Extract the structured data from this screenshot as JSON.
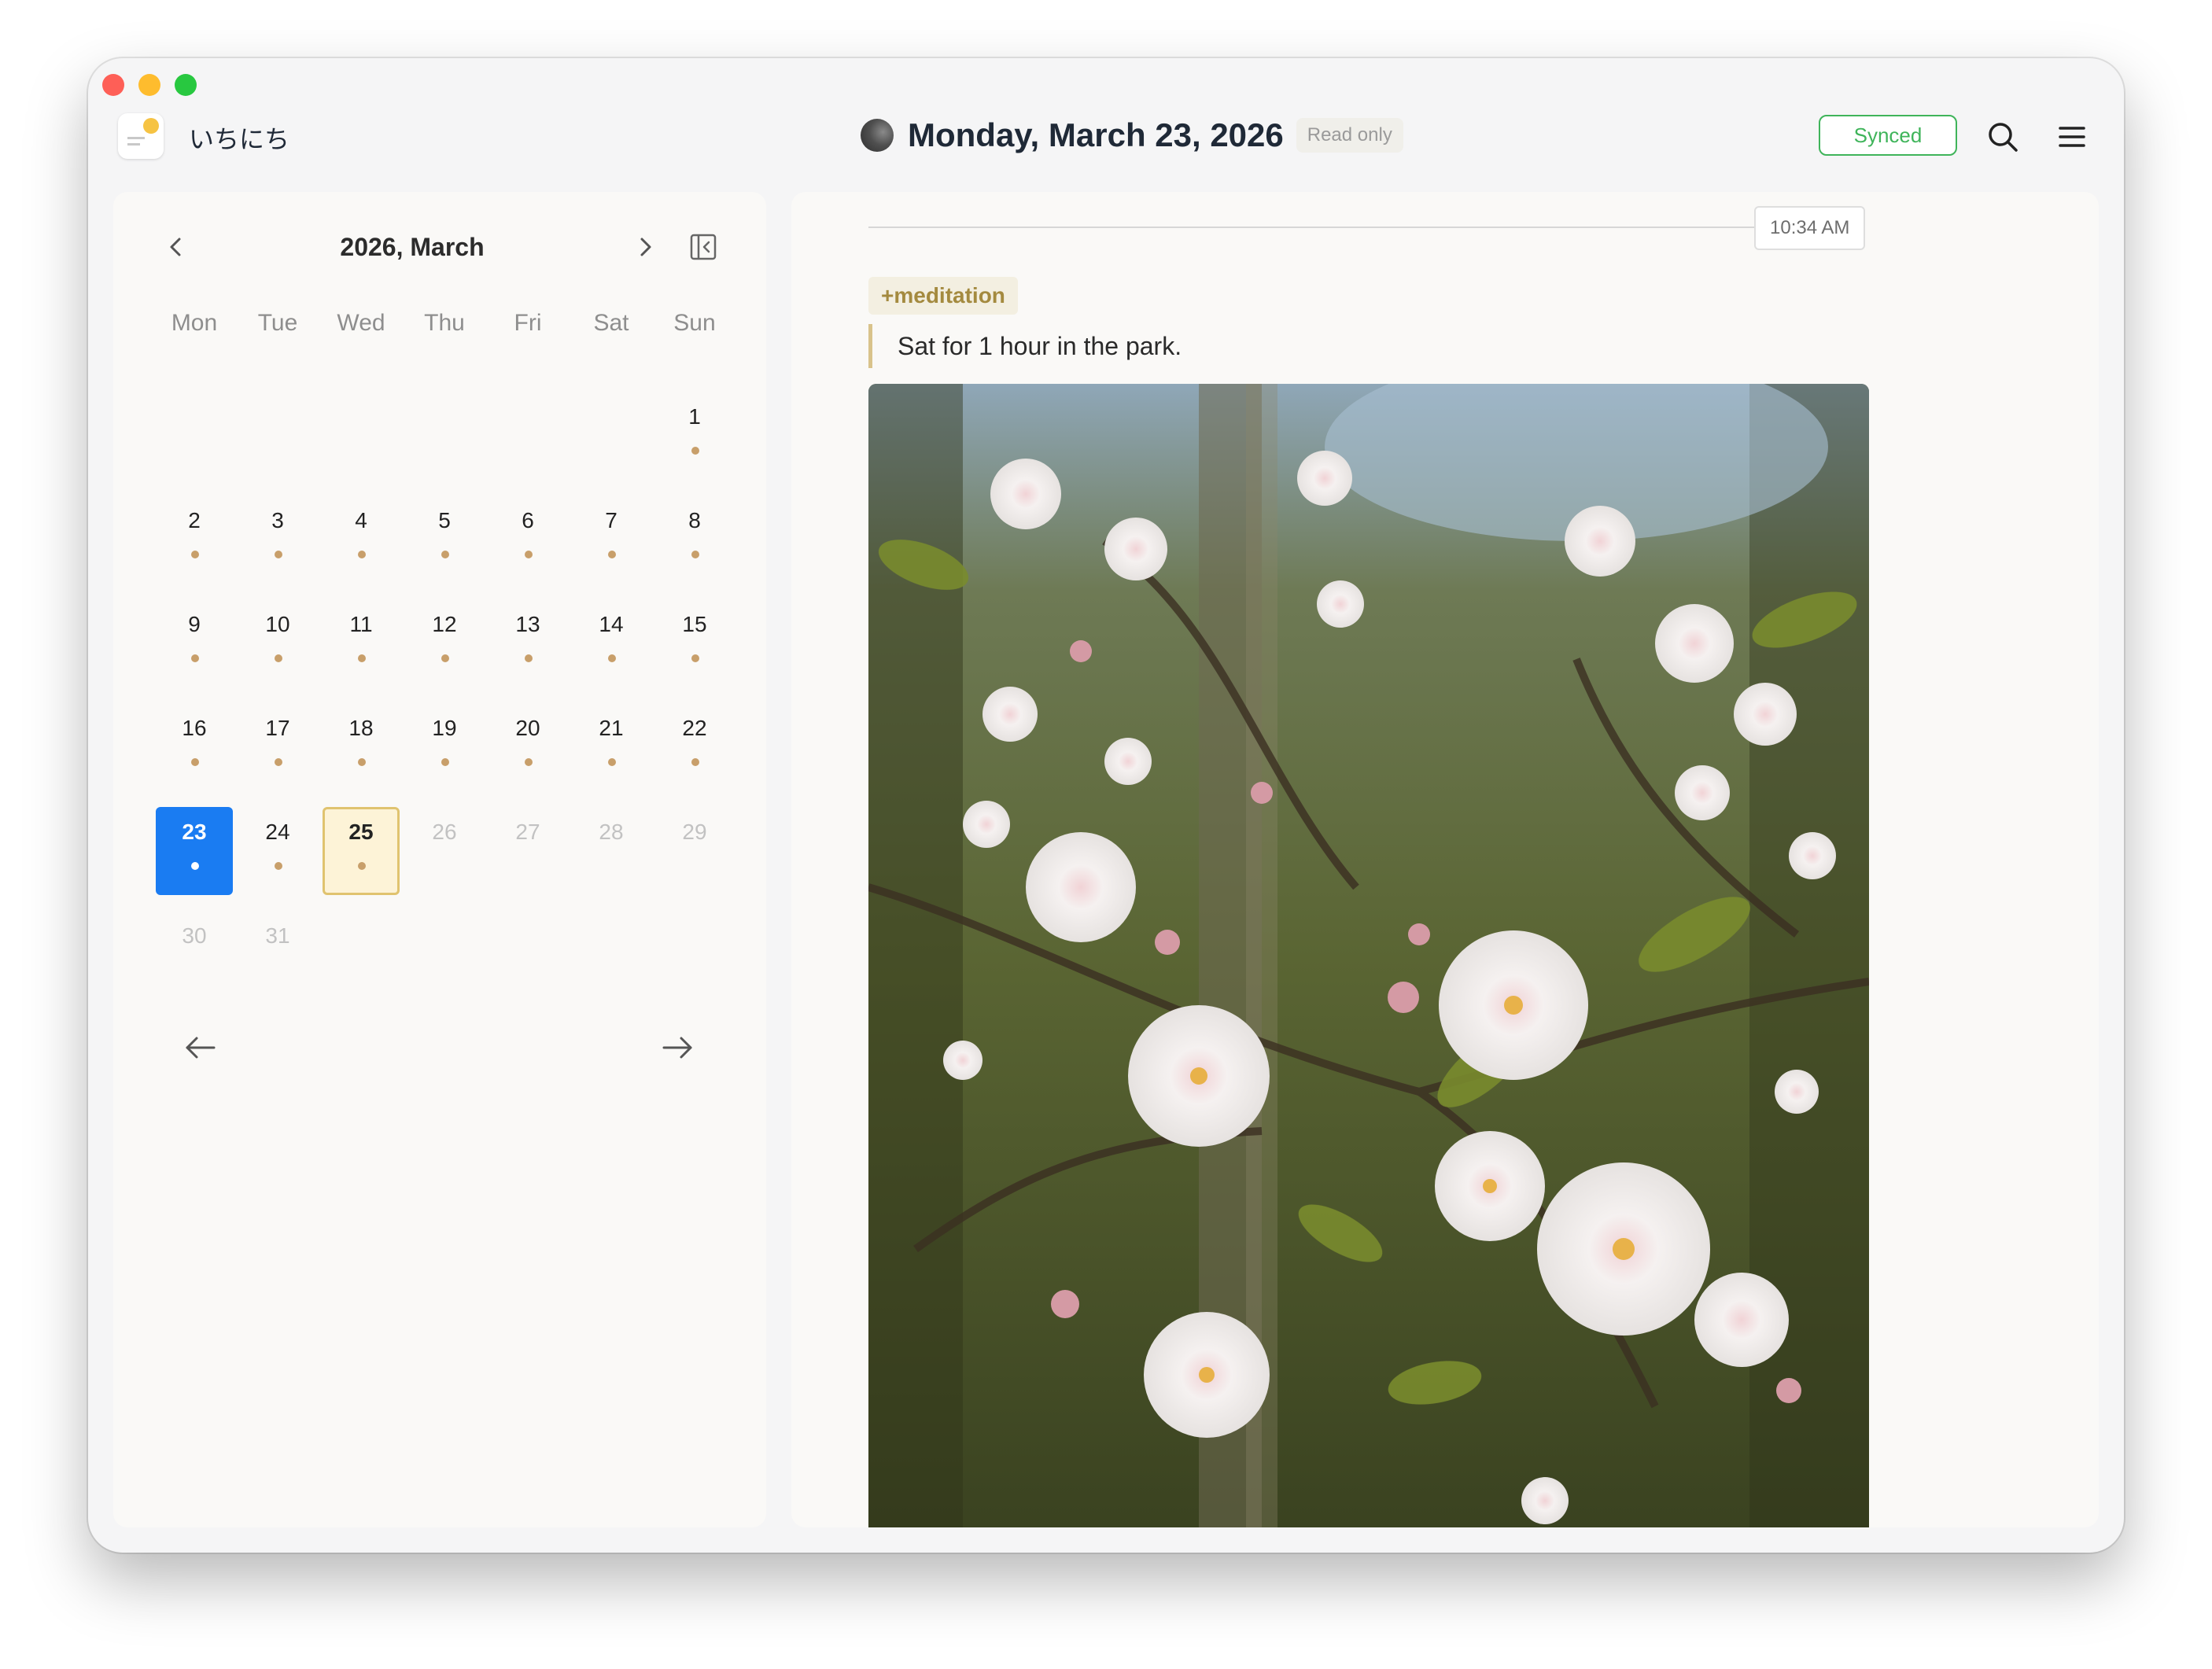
{
  "app": {
    "name": "いちにち"
  },
  "header": {
    "date_title": "Monday, March 23, 2026",
    "read_only_label": "Read only",
    "synced_label": "Synced",
    "moon_icon": "moon-phase-icon",
    "search_icon": "search-icon",
    "menu_icon": "hamburger-menu-icon"
  },
  "calendar": {
    "title": "2026, March",
    "weekdays": [
      "Mon",
      "Tue",
      "Wed",
      "Thu",
      "Fri",
      "Sat",
      "Sun"
    ],
    "days": [
      {
        "n": "",
        "dot": false,
        "state": "empty"
      },
      {
        "n": "",
        "dot": false,
        "state": "empty"
      },
      {
        "n": "",
        "dot": false,
        "state": "empty"
      },
      {
        "n": "",
        "dot": false,
        "state": "empty"
      },
      {
        "n": "",
        "dot": false,
        "state": "empty"
      },
      {
        "n": "",
        "dot": false,
        "state": "empty"
      },
      {
        "n": "1",
        "dot": true,
        "state": "normal"
      },
      {
        "n": "2",
        "dot": true,
        "state": "normal"
      },
      {
        "n": "3",
        "dot": true,
        "state": "normal"
      },
      {
        "n": "4",
        "dot": true,
        "state": "normal"
      },
      {
        "n": "5",
        "dot": true,
        "state": "normal"
      },
      {
        "n": "6",
        "dot": true,
        "state": "normal"
      },
      {
        "n": "7",
        "dot": true,
        "state": "normal"
      },
      {
        "n": "8",
        "dot": true,
        "state": "normal"
      },
      {
        "n": "9",
        "dot": true,
        "state": "normal"
      },
      {
        "n": "10",
        "dot": true,
        "state": "normal"
      },
      {
        "n": "11",
        "dot": true,
        "state": "normal"
      },
      {
        "n": "12",
        "dot": true,
        "state": "normal"
      },
      {
        "n": "13",
        "dot": true,
        "state": "normal"
      },
      {
        "n": "14",
        "dot": true,
        "state": "normal"
      },
      {
        "n": "15",
        "dot": true,
        "state": "normal"
      },
      {
        "n": "16",
        "dot": true,
        "state": "normal"
      },
      {
        "n": "17",
        "dot": true,
        "state": "normal"
      },
      {
        "n": "18",
        "dot": true,
        "state": "normal"
      },
      {
        "n": "19",
        "dot": true,
        "state": "normal"
      },
      {
        "n": "20",
        "dot": true,
        "state": "normal"
      },
      {
        "n": "21",
        "dot": true,
        "state": "normal"
      },
      {
        "n": "22",
        "dot": true,
        "state": "normal"
      },
      {
        "n": "23",
        "dot": true,
        "state": "selected"
      },
      {
        "n": "24",
        "dot": true,
        "state": "normal"
      },
      {
        "n": "25",
        "dot": true,
        "state": "today"
      },
      {
        "n": "26",
        "dot": false,
        "state": "future"
      },
      {
        "n": "27",
        "dot": false,
        "state": "future"
      },
      {
        "n": "28",
        "dot": false,
        "state": "future"
      },
      {
        "n": "29",
        "dot": false,
        "state": "future"
      },
      {
        "n": "30",
        "dot": false,
        "state": "future"
      },
      {
        "n": "31",
        "dot": false,
        "state": "future"
      }
    ],
    "prev_icon": "chevron-left-icon",
    "next_icon": "chevron-right-icon",
    "collapse_icon": "sidebar-collapse-icon",
    "back_icon": "arrow-left-icon",
    "forward_icon": "arrow-right-icon"
  },
  "entry": {
    "time": "10:34 AM",
    "tag": "+meditation",
    "text": "Sat for 1 hour in the park.",
    "image_icon": "photo-icon"
  },
  "colors": {
    "accent_blue": "#1a7cf2",
    "synced_green": "#3fb45a",
    "entry_dot": "#c89f6a",
    "tag_text": "#a48a3f"
  }
}
